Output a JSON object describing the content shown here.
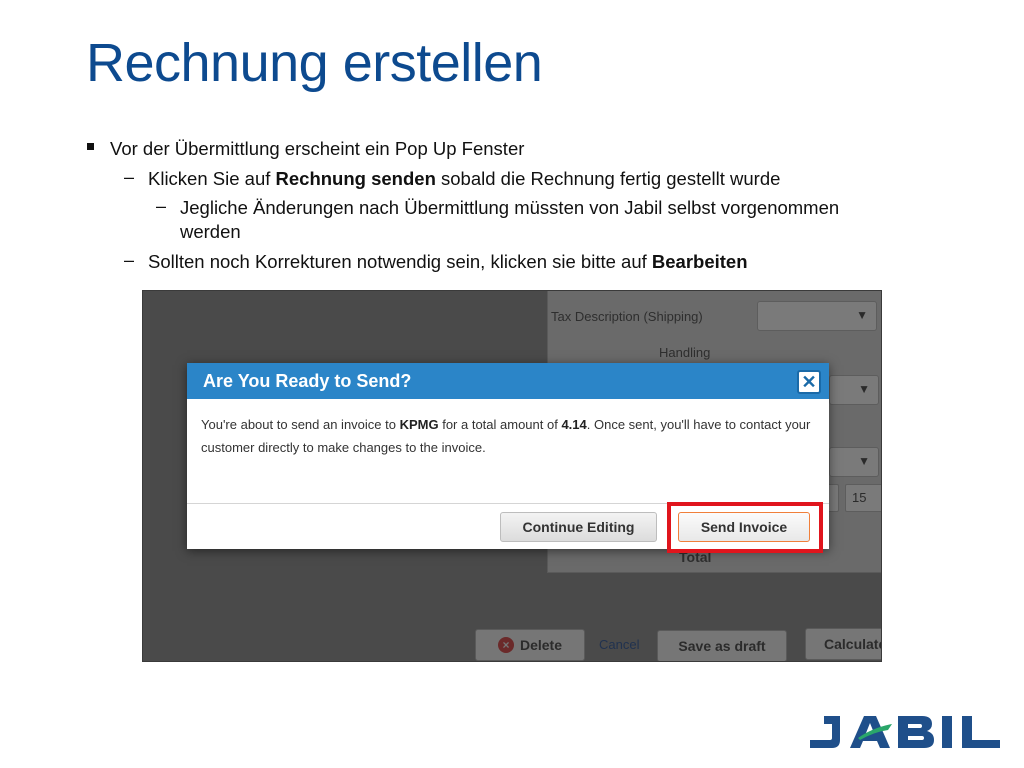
{
  "slide": {
    "title": "Rechnung erstellen"
  },
  "bullets": {
    "l1_text": "Vor der Übermittlung erscheint ein Pop Up Fenster",
    "l2a_pre": "Klicken Sie auf ",
    "l2a_bold": "Rechnung senden",
    "l2a_post": " sobald die Rechnung fertig gestellt wurde",
    "l3_line1": "Jegliche Änderungen nach Übermittlung müssten von Jabil selbst vorgenommen",
    "l3_line2": "werden",
    "l2b_pre": "Sollten noch Korrekturen notwendig sein, klicken sie bitte auf ",
    "l2b_bold": "Bearbeiten",
    "dash": "–"
  },
  "screenshot": {
    "background": {
      "tax_description_label": "Tax Description (Shipping)",
      "handling_label": "Handling",
      "total_label": "Total",
      "qty_value": "15",
      "delete_button": "Delete",
      "cancel_link": "Cancel",
      "save_draft_button": "Save as draft",
      "calculate_button": "Calculate"
    },
    "modal": {
      "title": "Are You Ready to Send?",
      "body_pre": "You're about to send an invoice to ",
      "customer": "KPMG",
      "body_mid": " for a total amount of ",
      "amount": "4.14",
      "body_post": ". Once sent, you'll have to contact your customer directly to make changes to the invoice.",
      "continue_button": "Continue Editing",
      "send_button": "Send Invoice"
    },
    "highlight_color": "#e0151d",
    "header_color": "#2b85c8"
  },
  "logo": {
    "text": "JABIL",
    "color": "#1f4f8a",
    "accent_color": "#2aa66a"
  },
  "colors": {
    "title": "#0d4a8f"
  }
}
